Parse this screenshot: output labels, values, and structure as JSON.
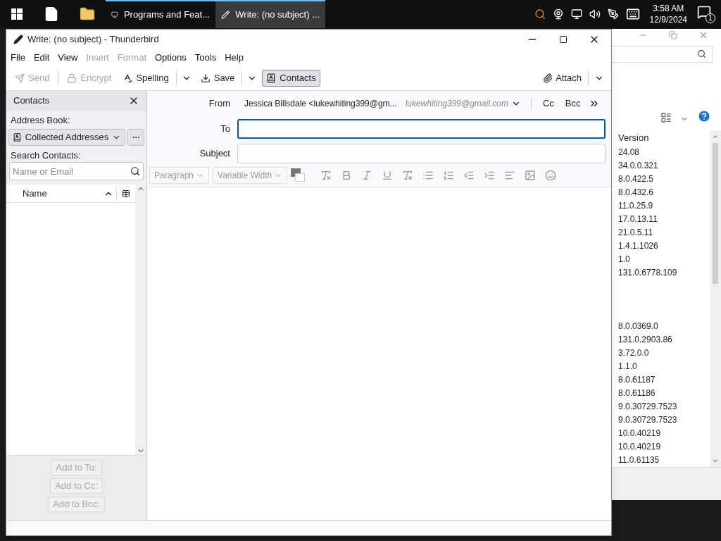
{
  "taskbar": {
    "buttons": [
      {
        "label": "Programs and Feat...",
        "selected": false
      },
      {
        "label": "Write: (no subject) ...",
        "selected": true
      }
    ],
    "time": "3:58 AM",
    "date": "12/9/2024",
    "notification_count": "1"
  },
  "background_window": {
    "column": "Version",
    "row_groups": [
      [
        "24.08",
        "34.0.0.321",
        "8.0.422.5",
        "8.0.432.6",
        "11.0.25.9",
        "17.0.13.11",
        "21.0.5.11",
        "1.4.1.1026",
        "1.0",
        "131.0.6778.109"
      ],
      [
        "8.0.0369.0",
        "131.0.2903.86",
        "3.72.0.0",
        "1.1.0",
        "8.0.61187",
        "8.0.61186",
        "9.0.30729.7523",
        "9.0.30729.7523",
        "10.0.40219",
        "10.0.40219",
        "11.0.61135"
      ]
    ]
  },
  "window": {
    "title": "Write: (no subject) - Thunderbird"
  },
  "menu": [
    {
      "label": "File",
      "disabled": false
    },
    {
      "label": "Edit",
      "disabled": false
    },
    {
      "label": "View",
      "disabled": false
    },
    {
      "label": "Insert",
      "disabled": true
    },
    {
      "label": "Format",
      "disabled": true
    },
    {
      "label": "Options",
      "disabled": false
    },
    {
      "label": "Tools",
      "disabled": false
    },
    {
      "label": "Help",
      "disabled": false
    }
  ],
  "toolbar": [
    {
      "kind": "send",
      "label": "Send",
      "disabled": true,
      "selected": false
    },
    {
      "kind": "encrypt",
      "label": "Encrypt",
      "disabled": true,
      "selected": false
    },
    {
      "kind": "spelling",
      "label": "Spelling",
      "disabled": false,
      "selected": false
    },
    {
      "kind": "save",
      "label": "Save",
      "disabled": false,
      "selected": false
    },
    {
      "kind": "contacts",
      "label": "Contacts",
      "disabled": false,
      "selected": true
    }
  ],
  "attach": "Attach",
  "contacts_pane": {
    "title": "Contacts",
    "address_book_label": "Address Book:",
    "address_book": "Collected Addresses",
    "search_label": "Search Contacts:",
    "search_placeholder": "Name or Email",
    "column": "Name",
    "buttons": [
      {
        "label": "Add to To:",
        "disabled": true
      },
      {
        "label": "Add to Cc:",
        "disabled": true
      },
      {
        "label": "Add to Bcc:",
        "disabled": true
      }
    ]
  },
  "header": {
    "from_label": "From",
    "from_value": "Jessica Billsdale <lukewhiting399@gm...",
    "from_email": "lukewhiting399@gmail.com",
    "cc": "Cc",
    "bcc": "Bcc",
    "to_label": "To",
    "subject_label": "Subject"
  },
  "format_bar": {
    "paragraph": "Paragraph",
    "font": "Variable Width"
  }
}
